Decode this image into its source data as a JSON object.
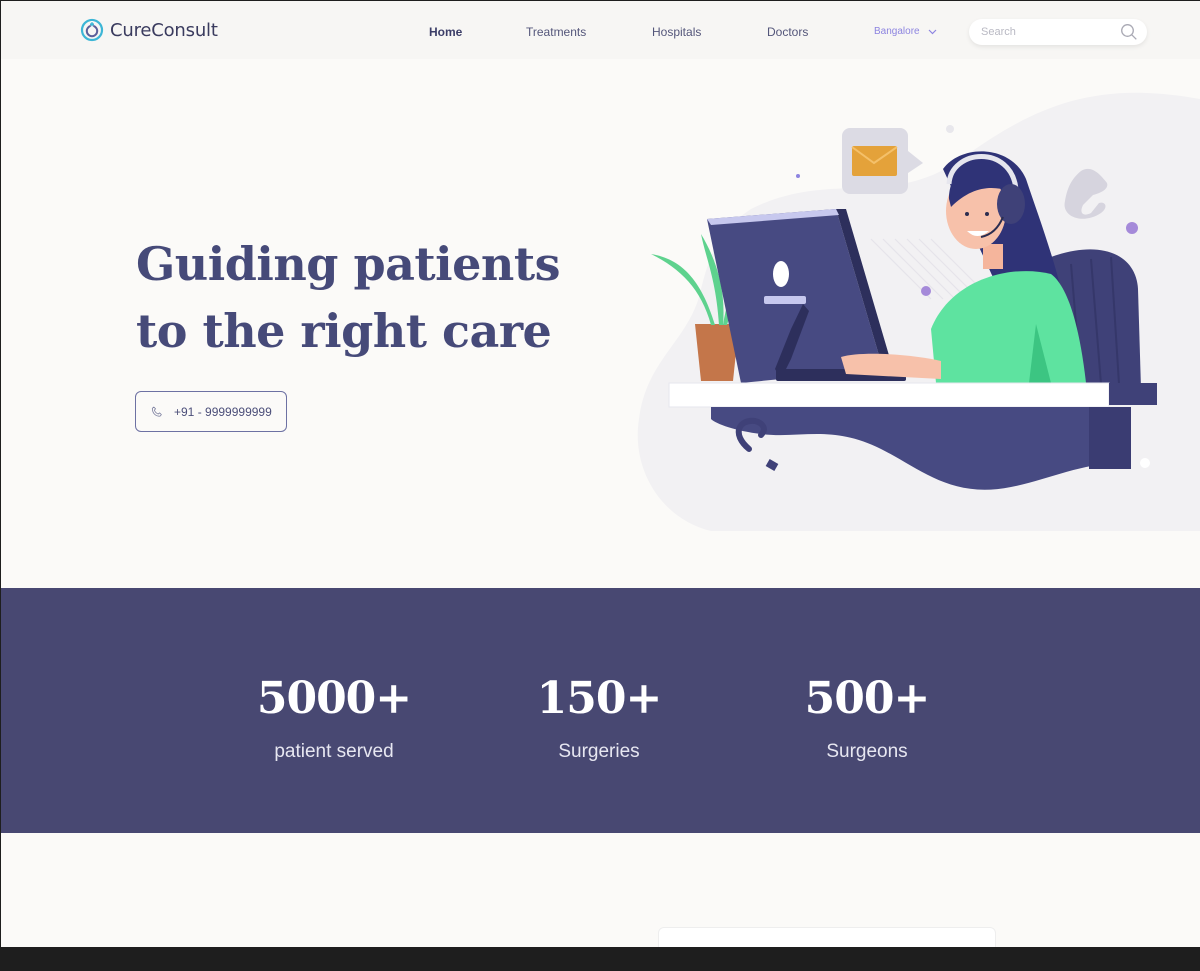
{
  "brand": {
    "name": "CureConsult"
  },
  "nav": {
    "items": [
      {
        "label": "Home",
        "active": true
      },
      {
        "label": "Treatments",
        "active": false
      },
      {
        "label": "Hospitals",
        "active": false
      },
      {
        "label": "Doctors",
        "active": false
      }
    ],
    "location": "Bangalore",
    "search_placeholder": "Search"
  },
  "hero": {
    "title_line1": "Guiding patients",
    "title_line2": "to the right care",
    "phone": "+91 - 9999999999"
  },
  "stats": [
    {
      "value": "5000+",
      "label": "patient served"
    },
    {
      "value": "150+",
      "label": "Surgeries"
    },
    {
      "value": "500+",
      "label": "Surgeons"
    }
  ],
  "colors": {
    "brand_navy": "#464a79",
    "stats_band": "#484872",
    "accent_lavender": "#8d84e0",
    "logo_teal": "#3db6d6"
  },
  "icons": [
    "logo-icon",
    "chevron-down-icon",
    "search-icon",
    "phone-icon"
  ]
}
